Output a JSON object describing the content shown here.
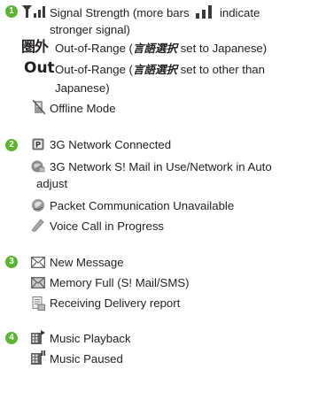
{
  "sections": [
    {
      "number": "1"
    },
    {
      "number": "2"
    },
    {
      "number": "3"
    },
    {
      "number": "4"
    }
  ],
  "items": {
    "signal": {
      "line1_a": "Signal Strength (more bars",
      "line1_b": "indicate",
      "line2": "stronger signal)",
      "icon": "signal-strength-icon"
    },
    "oor_jp": {
      "glyph": "圏外",
      "text_a": "Out-of-Range (",
      "jp": "言語選択",
      "text_b": " set to Japanese)",
      "icon": "out-of-range-japanese-icon"
    },
    "oor_other": {
      "glyph": "Out",
      "text_a": "Out-of-Range (",
      "jp": "言語選択",
      "text_b": " set to other than",
      "line2": "Japanese)",
      "icon": "out-of-range-other-icon"
    },
    "offline": {
      "text": "Offline Mode",
      "icon": "offline-mode-icon"
    },
    "net3g": {
      "text": "3G Network Connected",
      "icon": "3g-network-icon"
    },
    "smail": {
      "line1": "3G Network S! Mail in Use/Network in Auto",
      "line2": "adjust",
      "icon": "smail-network-icon"
    },
    "packet": {
      "text": "Packet Communication Unavailable",
      "icon": "packet-unavailable-icon"
    },
    "voice": {
      "text": "Voice Call in Progress",
      "icon": "voice-call-icon"
    },
    "newmsg": {
      "text": "New Message",
      "icon": "new-message-icon"
    },
    "memfull": {
      "text": "Memory Full (S! Mail/SMS)",
      "icon": "memory-full-icon"
    },
    "delivery": {
      "text": "Receiving Delivery report",
      "icon": "delivery-report-icon"
    },
    "play": {
      "text": "Music Playback",
      "icon": "music-playback-icon"
    },
    "pause": {
      "text": "Music Paused",
      "icon": "music-paused-icon"
    }
  },
  "colors": {
    "accent": "#5cb531",
    "text": "#231f20",
    "icon_gray": "#7a7a7a"
  }
}
